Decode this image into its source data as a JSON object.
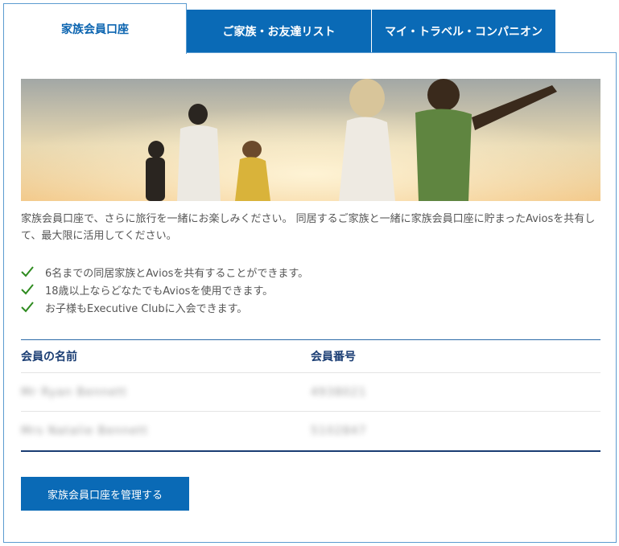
{
  "tabs": [
    {
      "label": "家族会員口座",
      "active": true
    },
    {
      "label": "ご家族・お友達リスト",
      "active": false
    },
    {
      "label": "マイ・トラベル・コンパニオン",
      "active": false
    }
  ],
  "intro": "家族会員口座で、さらに旅行を一緒にお楽しみください。 同居するご家族と一緒に家族会員口座に貯まったAviosを共有して、最大限に活用してください。",
  "features": [
    "6名までの同居家族とAviosを共有することができます。",
    "18歳以上ならどなたでもAviosを使用できます。",
    "お子様もExecutive Clubに入会できます。"
  ],
  "table": {
    "headers": [
      "会員の名前",
      "会員番号"
    ],
    "rows": [
      {
        "name": "Mr Ryan Bennett",
        "number": "4938021"
      },
      {
        "name": "Mrs Natalie Bennett",
        "number": "5102847"
      }
    ]
  },
  "manage_button": "家族会員口座を管理する",
  "colors": {
    "accent": "#0a6ab6",
    "heading": "#1a3d73",
    "check": "#2e8b1f"
  }
}
